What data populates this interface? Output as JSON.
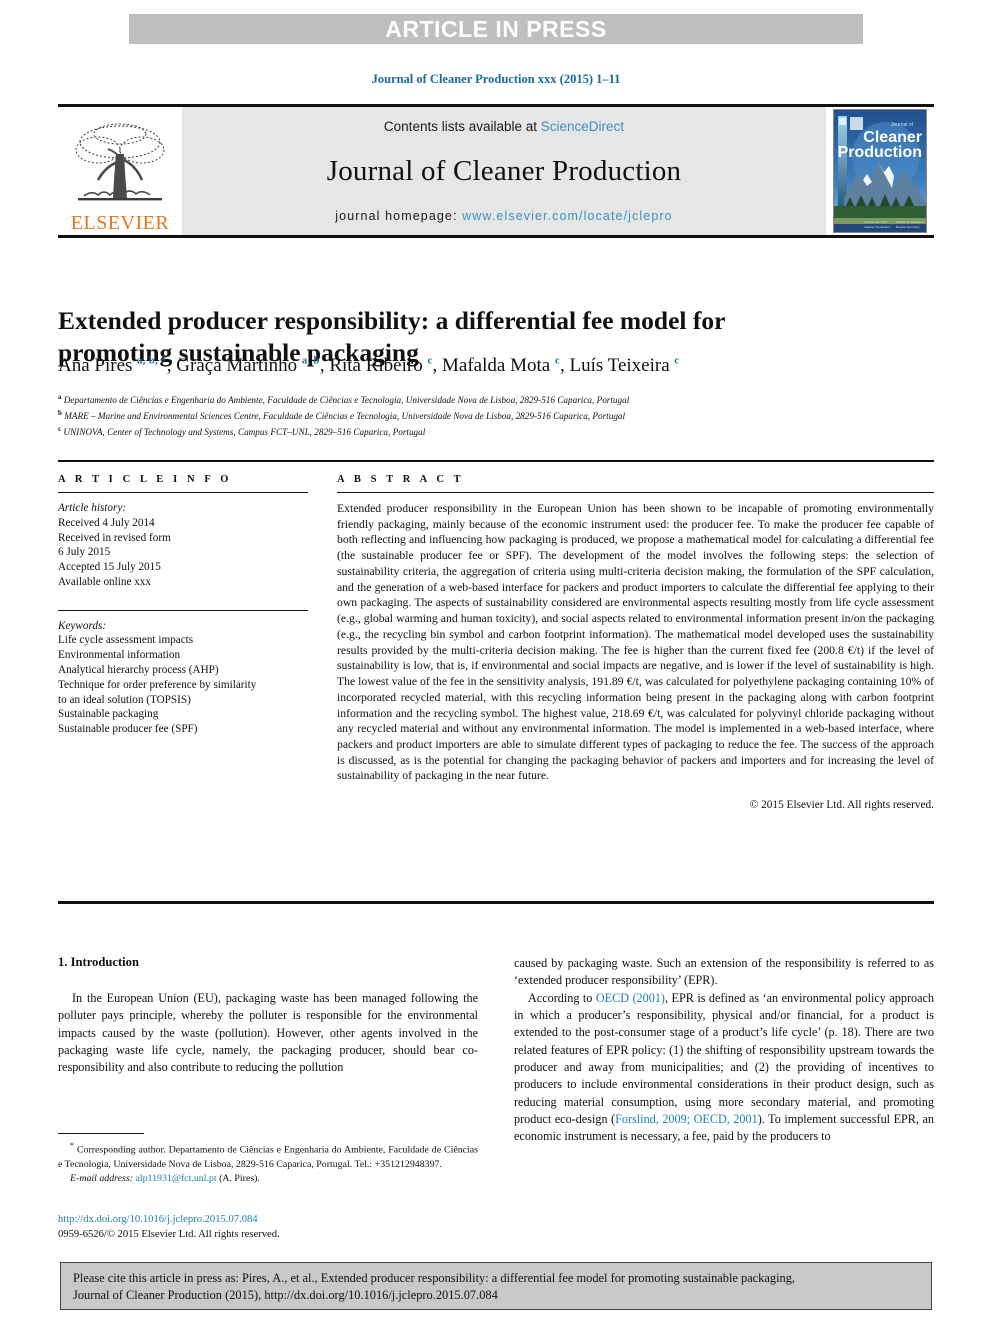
{
  "banner": {
    "label": "ARTICLE IN PRESS"
  },
  "running_head": "Journal of Cleaner Production xxx (2015) 1–11",
  "masthead": {
    "contents_prefix": "Contents lists available at",
    "sciencedirect": "ScienceDirect",
    "journal_title": "Journal of Cleaner Production",
    "homepage_prefix": "journal homepage:",
    "homepage_url": "www.elsevier.com/locate/jclepro",
    "publisher": "ELSEVIER",
    "cover_title_line1": "Cleaner",
    "cover_title_line2": "Production",
    "cover_kicker": "Journal of"
  },
  "article": {
    "title": "Extended producer responsibility: a differential fee model for promoting sustainable packaging",
    "authors": [
      {
        "name": "Ana Pires",
        "marks": "a, b, *"
      },
      {
        "name": "Graça Martinho",
        "marks": "a, b"
      },
      {
        "name": "Rita Ribeiro",
        "marks": "c"
      },
      {
        "name": "Mafalda Mota",
        "marks": "c"
      },
      {
        "name": "Luís Teixeira",
        "marks": "c"
      }
    ],
    "affiliations": [
      {
        "mark": "a",
        "text": "Departamento de Ciências e Engenharia do Ambiente, Faculdade de Ciências e Tecnologia, Universidade Nova de Lisboa, 2829-516 Caparica, Portugal"
      },
      {
        "mark": "b",
        "text": "MARE – Marine and Environmental Sciences Centre, Faculdade de Ciências e Tecnologia, Universidade Nova de Lisboa, 2829-516 Caparica, Portugal"
      },
      {
        "mark": "c",
        "text": "UNINOVA, Center of Technology and Systems, Campus FCT–UNL, 2829–516 Caparica, Portugal"
      }
    ]
  },
  "article_info": {
    "heading": "A R T I C L E  I N F O",
    "history_label": "Article history:",
    "history": [
      "Received 4 July 2014",
      "Received in revised form",
      "6 July 2015",
      "Accepted 15 July 2015",
      "Available online xxx"
    ],
    "keywords_label": "Keywords:",
    "keywords": [
      "Life cycle assessment impacts",
      "Environmental information",
      "Analytical hierarchy process (AHP)",
      "Technique for order preference by similarity",
      "to an ideal solution (TOPSIS)",
      "Sustainable packaging",
      "Sustainable producer fee (SPF)"
    ]
  },
  "abstract": {
    "heading": "A B S T R A C T",
    "text": "Extended producer responsibility in the European Union has been shown to be incapable of promoting environmentally friendly packaging, mainly because of the economic instrument used: the producer fee. To make the producer fee capable of both reflecting and influencing how packaging is produced, we propose a mathematical model for calculating a differential fee (the sustainable producer fee or SPF). The development of the model involves the following steps: the selection of sustainability criteria, the aggregation of criteria using multi-criteria decision making, the formulation of the SPF calculation, and the generation of a web-based interface for packers and product importers to calculate the differential fee applying to their own packaging. The aspects of sustainability considered are environmental aspects resulting mostly from life cycle assessment (e.g., global warming and human toxicity), and social aspects related to environmental information present in/on the packaging (e.g., the recycling bin symbol and carbon footprint information). The mathematical model developed uses the sustainability results provided by the multi-criteria decision making. The fee is higher than the current fixed fee (200.8 €/t) if the level of sustainability is low, that is, if environmental and social impacts are negative, and is lower if the level of sustainability is high. The lowest value of the fee in the sensitivity analysis, 191.89 €/t, was calculated for polyethylene packaging containing 10% of incorporated recycled material, with this recycling information being present in the packaging along with carbon footprint information and the recycling symbol. The highest value, 218.69 €/t, was calculated for polyvinyl chloride packaging without any recycled material and without any environmental information. The model is implemented in a web-based interface, where packers and product importers are able to simulate different types of packaging to reduce the fee. The success of the approach is discussed, as is the potential for changing the packaging behavior of packers and importers and for increasing the level of sustainability of packaging in the near future.",
    "copyright": "© 2015 Elsevier Ltd. All rights reserved."
  },
  "introduction": {
    "heading": "1. Introduction",
    "left_paragraph": "In the European Union (EU), packaging waste has been managed following the polluter pays principle, whereby the polluter is responsible for the environmental impacts caused by the waste (pollution). However, other agents involved in the packaging waste life cycle, namely, the packaging producer, should bear co-responsibility and also contribute to reducing the pollution",
    "right_paragraph_1": "caused by packaging waste. Such an extension of the responsibility is referred to as ‘extended producer responsibility’ (EPR).",
    "right_paragraph_2_pre": "According to ",
    "right_paragraph_2_link1": "OECD (2001)",
    "right_paragraph_2_mid": ", EPR is defined as ‘an environmental policy approach in which a producer’s responsibility, physical and/or financial, for a product is extended to the post-consumer stage of a product’s life cycle’ (p. 18). There are two related features of EPR policy: (1) the shifting of responsibility upstream towards the producer and away from municipalities; and (2) the providing of incentives to producers to include environmental considerations in their product design, such as reducing material consumption, using more secondary material, and promoting product eco-design (",
    "right_paragraph_2_link2": "Forslind, 2009; OECD, 2001",
    "right_paragraph_2_post": "). To implement successful EPR, an economic instrument is necessary, a fee, paid by the producers to"
  },
  "footnotes": {
    "corresponding": "Corresponding author. Departamento de Ciências e Engenharia do Ambiente, Faculdade de Ciências e Tecnologia, Universidade Nova de Lisboa, 2829-516 Caparica, Portugal. Tel.: +351212948397.",
    "email_label": "E-mail address:",
    "email": "alp11931@fct.unl.pt",
    "email_suffix": "(A. Pires)."
  },
  "doi": {
    "url": "http://dx.doi.org/10.1016/j.jclepro.2015.07.084",
    "issn_line": "0959-6526/© 2015 Elsevier Ltd. All rights reserved."
  },
  "cite_box": {
    "line1": "Please cite this article in press as: Pires, A., et al., Extended producer responsibility: a differential fee model for promoting sustainable packaging,",
    "line2": "Journal of Cleaner Production (2015), http://dx.doi.org/10.1016/j.jclepro.2015.07.084"
  },
  "colors": {
    "banner_bg": "#bfbfbf",
    "link_blue": "#1b7fb5",
    "elsevier_orange": "#e8761f",
    "masthead_bg": "#e6e6e6",
    "cite_box_bg": "#c9c9c9"
  }
}
